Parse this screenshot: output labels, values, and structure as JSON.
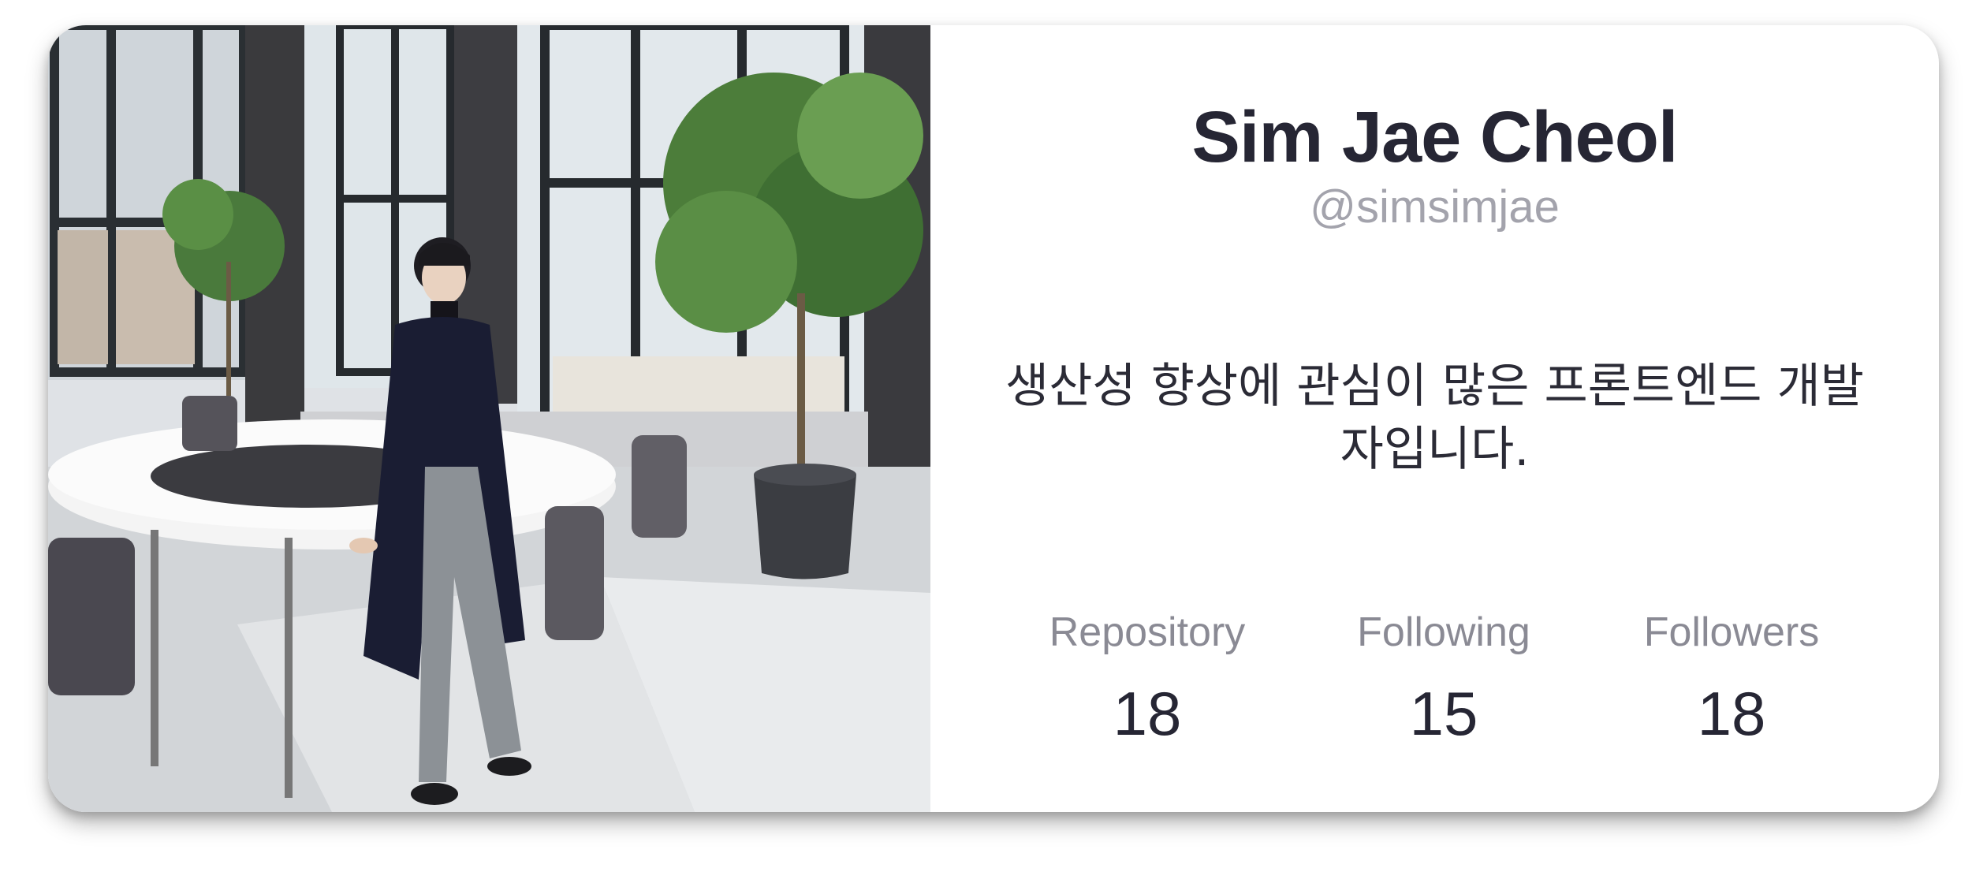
{
  "profile": {
    "name": "Sim Jae Cheol",
    "handle": "@simsimjae",
    "bio": "생산성 향상에 관심이 많은 프론트엔드 개발자입니다."
  },
  "stats": [
    {
      "label": "Repository",
      "value": "18"
    },
    {
      "label": "Following",
      "value": "15"
    },
    {
      "label": "Followers",
      "value": "18"
    }
  ],
  "colors": {
    "name_text": "#262634",
    "handle_text": "#a3a3ac",
    "stat_label_text": "#8a8a94"
  },
  "icons": {
    "profile_photo": "person-photo"
  }
}
